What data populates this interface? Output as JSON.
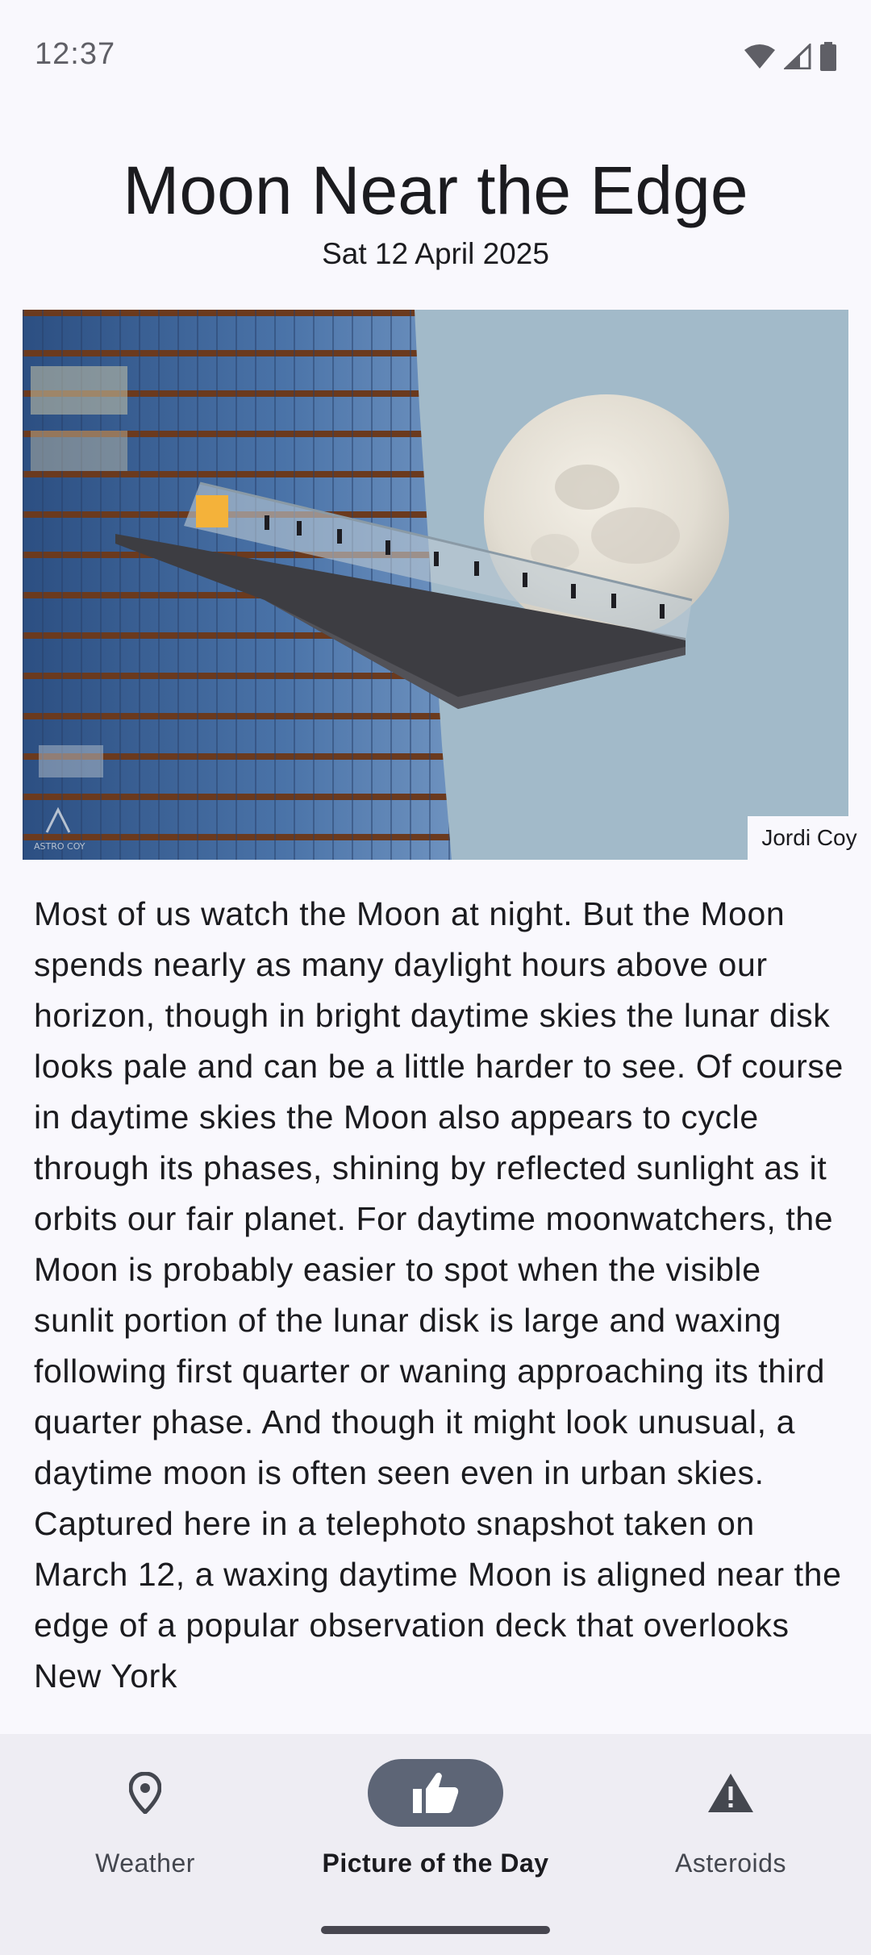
{
  "status_bar": {
    "time": "12:37"
  },
  "apod": {
    "title": "Moon Near the Edge",
    "date": "Sat 12 April 2025",
    "credit": "Jordi Coy",
    "watermark": "ASTRO COY",
    "explanation": "Most of us watch the Moon at night. But the Moon spends nearly as many daylight hours above our horizon, though in bright daytime skies the lunar disk looks pale and can be a little harder to see. Of course in daytime skies the Moon also appears to cycle through its phases, shining by reflected sunlight as it orbits our fair planet. For daytime moonwatchers, the Moon is probably easier to spot when the visible sunlit portion of the lunar disk is large and waxing following first quarter or waning approaching its third quarter phase. And though it might look unusual, a daytime moon is often seen even in urban skies. Captured here in a telephoto snapshot taken on March 12, a waxing daytime Moon is aligned near the edge of a popular observation deck that overlooks New York"
  },
  "nav": {
    "items": [
      {
        "label": "Weather",
        "icon": "location-pin-icon",
        "active": false
      },
      {
        "label": "Picture of the Day",
        "icon": "thumb-up-icon",
        "active": true
      },
      {
        "label": "Asteroids",
        "icon": "warning-triangle-icon",
        "active": false
      }
    ]
  },
  "colors": {
    "background": "#f9f8fd",
    "nav_background": "#eeedf3",
    "active_indicator": "#5d6576",
    "sky": "#a2bac9"
  }
}
